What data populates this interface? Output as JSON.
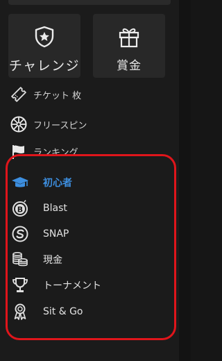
{
  "tiles": {
    "challenge": {
      "label": "チャレンジ",
      "icon": "shield-star-icon"
    },
    "prize": {
      "label": "賞金",
      "icon": "gift-icon"
    }
  },
  "menu": [
    {
      "label": "チケット 枚",
      "icon": "ticket-icon"
    },
    {
      "label": "フリースピン",
      "icon": "wheel-icon"
    },
    {
      "label": "ランキング",
      "icon": "flag-icon"
    }
  ],
  "games": [
    {
      "label": "初心者",
      "icon": "graduation-cap-icon",
      "active": true
    },
    {
      "label": "Blast",
      "icon": "bomb-icon",
      "active": false
    },
    {
      "label": "SNAP",
      "icon": "snap-icon",
      "active": false
    },
    {
      "label": "現金",
      "icon": "coins-icon",
      "active": false
    },
    {
      "label": "トーナメント",
      "icon": "trophy-icon",
      "active": false
    },
    {
      "label": "Sit & Go",
      "icon": "ribbon-icon",
      "active": false
    }
  ],
  "colors": {
    "accent": "#3d8fe0",
    "highlight_border": "#e0151b",
    "panel": "#1b1b1b",
    "tile": "#282828"
  }
}
